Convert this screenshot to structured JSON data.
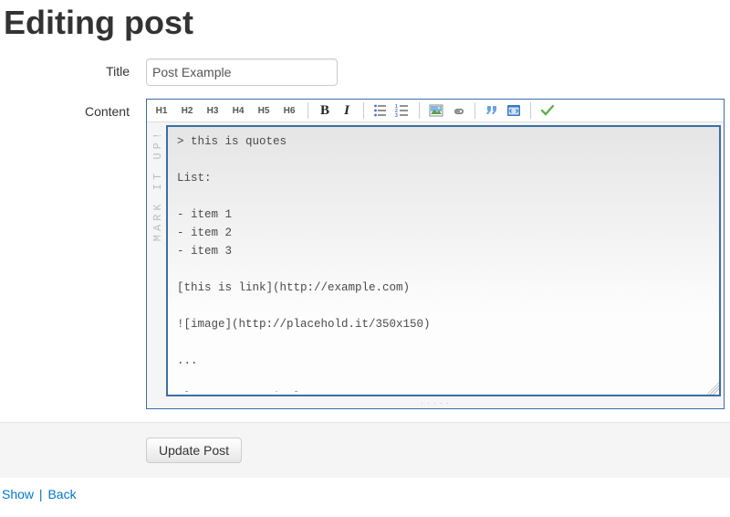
{
  "page": {
    "heading": "Editing post"
  },
  "form": {
    "title_label": "Title",
    "title_value": "Post Example",
    "content_label": "Content",
    "submit_label": "Update Post"
  },
  "toolbar": {
    "h1": "H1",
    "h2": "H2",
    "h3": "H3",
    "h4": "H4",
    "h5": "H5",
    "h6": "H6",
    "bold": "B",
    "italic": "I"
  },
  "editor": {
    "gutter_text": "MARK IT UP!",
    "content": "> this is quotes\n\nList:\n\n- item 1\n- item 2\n- item 3\n\n[this is link](http://example.com)\n\n![image](http://placehold.it/350x150)\n\n...\n\nclass Cat < Animal\n  def say\n    \"Meow!\"\n  end\nend"
  },
  "links": {
    "show": "Show",
    "back": "Back"
  }
}
